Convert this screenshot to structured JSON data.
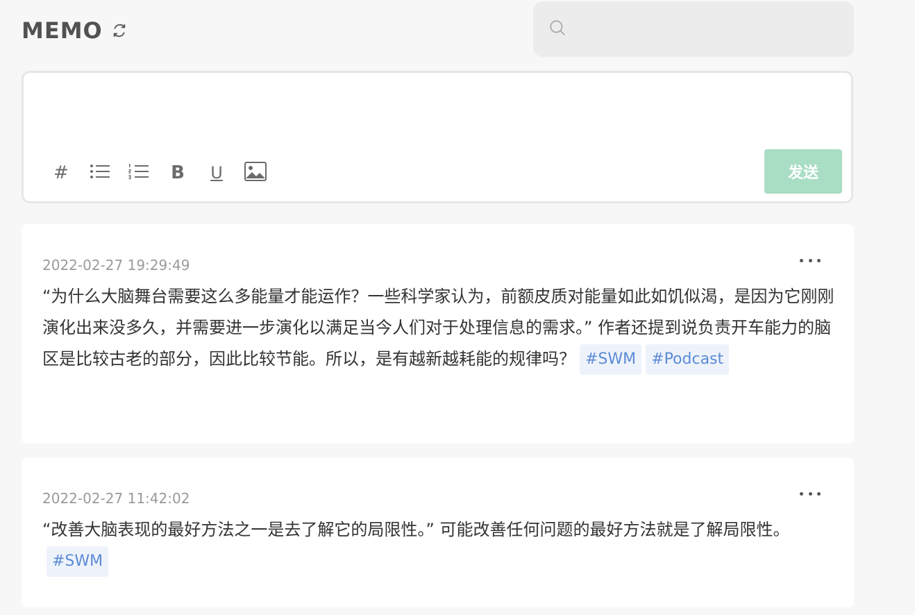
{
  "header": {
    "title": "MEMO",
    "refresh_icon": "refresh-icon"
  },
  "search": {
    "placeholder": "",
    "value": "",
    "icon": "search-icon"
  },
  "editor": {
    "placeholder": "",
    "value": "",
    "toolbar": {
      "hash_label": "#",
      "bold_label": "B",
      "underline_label": "U",
      "icons": [
        "hash-icon",
        "bulleted-list-icon",
        "numbered-list-icon",
        "bold-icon",
        "underline-icon",
        "image-icon"
      ]
    },
    "send_label": "发送"
  },
  "colors": {
    "send_button": "#a9ddc4",
    "tag_bg": "#eef2fb",
    "tag_text": "#5b8bd6",
    "background": "#f7f7f7"
  },
  "memos": [
    {
      "time": "2022-02-27 19:29:49",
      "content": "“为什么大脑舞台需要这么多能量才能运作？一些科学家认为，前额皮质对能量如此如饥似渴，是因为它刚刚演化出来没多久，并需要进一步演化以满足当今人们对于处理信息的需求。” 作者还提到说负责开车能力的脑区是比较古老的部分，因此比较节能。所以，是有越新越耗能的规律吗？",
      "tags": [
        "#SWM",
        "#Podcast"
      ]
    },
    {
      "time": "2022-02-27 11:42:02",
      "content": "“改善大脑表现的最好方法之一是去了解它的局限性。” 可能改善任何问题的最好方法就是了解局限性。",
      "tags": [
        "#SWM"
      ]
    }
  ]
}
